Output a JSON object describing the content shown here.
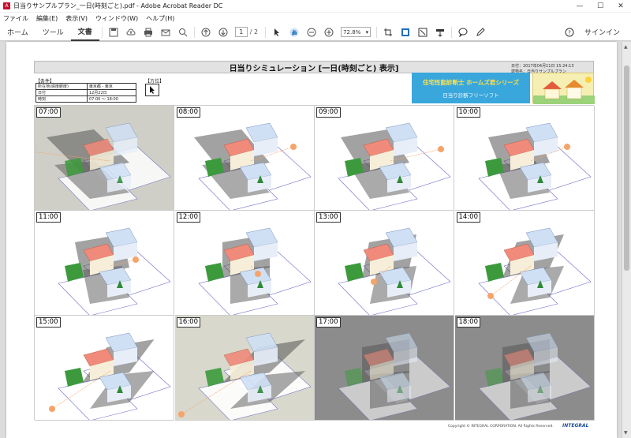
{
  "window": {
    "title": "日当りサンプルプラン_一日(時刻ごと).pdf - Adobe Acrobat Reader DC"
  },
  "menu": [
    "ファイル",
    "編集(E)",
    "表示(V)",
    "ウィンドウ(W)",
    "ヘルプ(H)"
  ],
  "toolbar": {
    "tabs": [
      "ホーム",
      "ツール",
      "文書"
    ],
    "active_tab": "文書",
    "page_current": "1",
    "page_total": "/ 2",
    "zoom": "72.8%",
    "signin": "サインイン"
  },
  "report": {
    "title": "日当りシミュレーション [一日(時刻ごと) 表示]",
    "meta_line1": "日付：2017年04月11日 15:24:13",
    "meta_line2": "建物名：日当りサンプルプラン",
    "conditions_label": "【条件】",
    "conditions": [
      [
        "所在地(緯度経度)",
        "東京都 - 東京"
      ],
      [
        "日付",
        "12月22日"
      ],
      [
        "時刻",
        "07:00 ～ 18:00"
      ]
    ],
    "direction_label": "【方位】",
    "banner_line1": "住宅性能診断士 ホームズ君シリーズ",
    "banner_line2": "日当り診断フリーソフト",
    "copyright": "Copyright © INTEGRAL CORPORATION. All Rights Reserved.",
    "brand": "INTEGRAL"
  },
  "cells": [
    {
      "time": "07:00"
    },
    {
      "time": "08:00"
    },
    {
      "time": "09:00"
    },
    {
      "time": "10:00"
    },
    {
      "time": "11:00"
    },
    {
      "time": "12:00"
    },
    {
      "time": "13:00"
    },
    {
      "time": "14:00"
    },
    {
      "time": "15:00"
    },
    {
      "time": "16:00"
    },
    {
      "time": "17:00"
    },
    {
      "time": "18:00"
    }
  ],
  "colors": {
    "banner": "#39a7dc",
    "roof": "#f08a7a",
    "neighbor": "#cfe0f5",
    "sun": "#f5a46a",
    "ground_green": "#3c9a3c"
  }
}
